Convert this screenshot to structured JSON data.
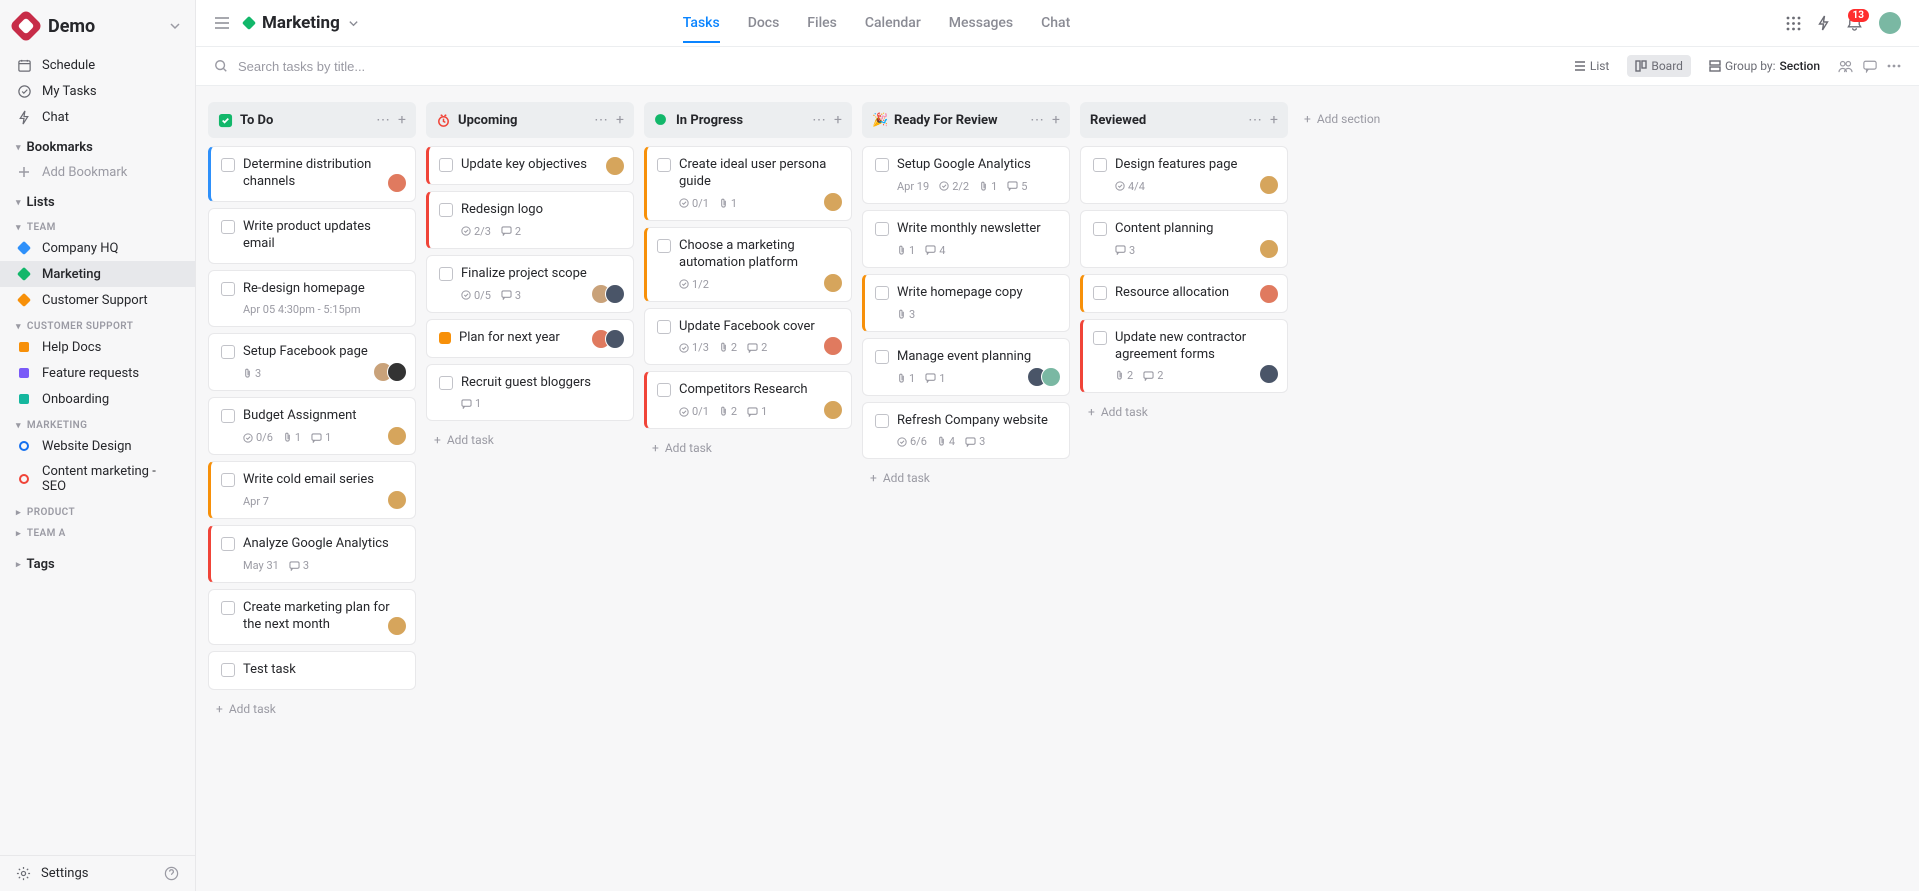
{
  "brand": "Demo",
  "project": {
    "name": "Marketing"
  },
  "topTabs": [
    "Tasks",
    "Docs",
    "Files",
    "Calendar",
    "Messages",
    "Chat"
  ],
  "notifCount": "13",
  "sidebar": {
    "nav": [
      {
        "label": "Schedule",
        "icon": "calendar"
      },
      {
        "label": "My Tasks",
        "icon": "check-circle"
      },
      {
        "label": "Chat",
        "icon": "bolt"
      }
    ],
    "bookmarks": {
      "title": "Bookmarks",
      "add": "Add Bookmark"
    },
    "lists": {
      "title": "Lists"
    },
    "groups": [
      {
        "title": "TEAM",
        "items": [
          {
            "label": "Company HQ",
            "color": "#2e90fa",
            "shape": "dot"
          },
          {
            "label": "Marketing",
            "color": "#12b76a",
            "shape": "dot",
            "active": true
          },
          {
            "label": "Customer Support",
            "color": "#f79009",
            "shape": "dot"
          }
        ]
      },
      {
        "title": "CUSTOMER SUPPORT",
        "items": [
          {
            "label": "Help Docs",
            "color": "#f79009",
            "shape": "sq"
          },
          {
            "label": "Feature requests",
            "color": "#7a5af8",
            "shape": "sq"
          },
          {
            "label": "Onboarding",
            "color": "#15b79e",
            "shape": "sq"
          }
        ]
      },
      {
        "title": "MARKETING",
        "items": [
          {
            "label": "Website Design",
            "color": "#1570ef",
            "shape": "cir"
          },
          {
            "label": "Content marketing - SEO",
            "color": "#f04438",
            "shape": "cir"
          }
        ]
      },
      {
        "title": "PRODUCT",
        "collapsed": true,
        "items": []
      },
      {
        "title": "TEAM A",
        "collapsed": true,
        "items": []
      }
    ],
    "tags": "Tags",
    "settings": "Settings"
  },
  "search": {
    "placeholder": "Search tasks by title..."
  },
  "views": {
    "list": "List",
    "board": "Board",
    "group": "Group by:",
    "groupVal": "Section"
  },
  "addSection": "Add section",
  "addTask": "Add task",
  "columns": [
    {
      "title": "To Do",
      "iconColor": "#12b76a",
      "iconType": "check",
      "cards": [
        {
          "title": "Determine distribution channels",
          "priority": "blue",
          "avatars": [
            "#e07a5f"
          ]
        },
        {
          "title": "Write product updates email"
        },
        {
          "title": "Re-design homepage",
          "date": "Apr 05 4:30pm - 5:15pm"
        },
        {
          "title": "Setup Facebook page",
          "attach": "3",
          "avatars": [
            "#c9a27a",
            "#333"
          ]
        },
        {
          "title": "Budget Assignment",
          "sub": "0/6",
          "attach": "1",
          "comments": "1",
          "avatars": [
            "#d6a55c"
          ]
        },
        {
          "title": "Write cold email series",
          "priority": "orange",
          "date": "Apr 7",
          "avatars": [
            "#d6a55c"
          ]
        },
        {
          "title": "Analyze Google Analytics",
          "priority": "red",
          "date": "May 31",
          "comments": "3"
        },
        {
          "title": "Create marketing plan for the next month",
          "avatars": [
            "#d6a55c"
          ]
        },
        {
          "title": "Test task"
        }
      ]
    },
    {
      "title": "Upcoming",
      "iconColor": "#f04438",
      "iconType": "clock",
      "cards": [
        {
          "title": "Update key objectives",
          "priority": "red",
          "avatars": [
            "#d6a55c"
          ]
        },
        {
          "title": "Redesign logo",
          "priority": "red",
          "sub": "2/3",
          "comments": "2"
        },
        {
          "title": "Finalize project scope",
          "sub": "0/5",
          "comments": "3",
          "avatars": [
            "#c9a27a",
            "#4a5568"
          ]
        },
        {
          "title": "Plan for next year",
          "planIcon": true,
          "avatars": [
            "#e07a5f",
            "#4a5568"
          ]
        },
        {
          "title": "Recruit guest bloggers",
          "comments": "1"
        }
      ]
    },
    {
      "title": "In Progress",
      "iconColor": "#12b76a",
      "iconType": "dot",
      "cards": [
        {
          "title": "Create ideal user persona guide",
          "priority": "orange",
          "sub": "0/1",
          "attach": "1",
          "avatars": [
            "#d6a55c"
          ]
        },
        {
          "title": "Choose a marketing automation platform",
          "priority": "orange",
          "sub": "1/2",
          "avatars": [
            "#d6a55c"
          ]
        },
        {
          "title": "Update Facebook cover",
          "sub": "1/3",
          "attach": "2",
          "comments": "2",
          "avatars": [
            "#e07a5f"
          ]
        },
        {
          "title": "Competitors Research",
          "priority": "red",
          "sub": "0/1",
          "attach": "2",
          "comments": "1",
          "avatars": [
            "#d6a55c"
          ]
        }
      ]
    },
    {
      "title": "Ready For Review",
      "iconType": "sparkle",
      "cards": [
        {
          "title": "Setup Google Analytics",
          "date": "Apr 19",
          "sub": "2/2",
          "attach": "1",
          "comments": "5"
        },
        {
          "title": "Write monthly newsletter",
          "attach": "1",
          "comments": "4"
        },
        {
          "title": "Write homepage copy",
          "priority": "orange",
          "attach": "3"
        },
        {
          "title": "Manage event planning",
          "attach": "1",
          "comments": "1",
          "avatars": [
            "#4a5568",
            "#7ab8a3"
          ]
        },
        {
          "title": "Refresh Company website",
          "sub": "6/6",
          "attach": "4",
          "comments": "3"
        }
      ]
    },
    {
      "title": "Reviewed",
      "cards": [
        {
          "title": "Design features page",
          "sub": "4/4",
          "avatars": [
            "#d6a55c"
          ]
        },
        {
          "title": "Content planning",
          "comments": "3",
          "avatars": [
            "#d6a55c"
          ]
        },
        {
          "title": "Resource allocation",
          "priority": "orange",
          "avatars": [
            "#e07a5f"
          ]
        },
        {
          "title": "Update new contractor agreement forms",
          "priority": "red",
          "attach": "2",
          "comments": "2",
          "avatars": [
            "#4a5568"
          ]
        }
      ]
    }
  ]
}
